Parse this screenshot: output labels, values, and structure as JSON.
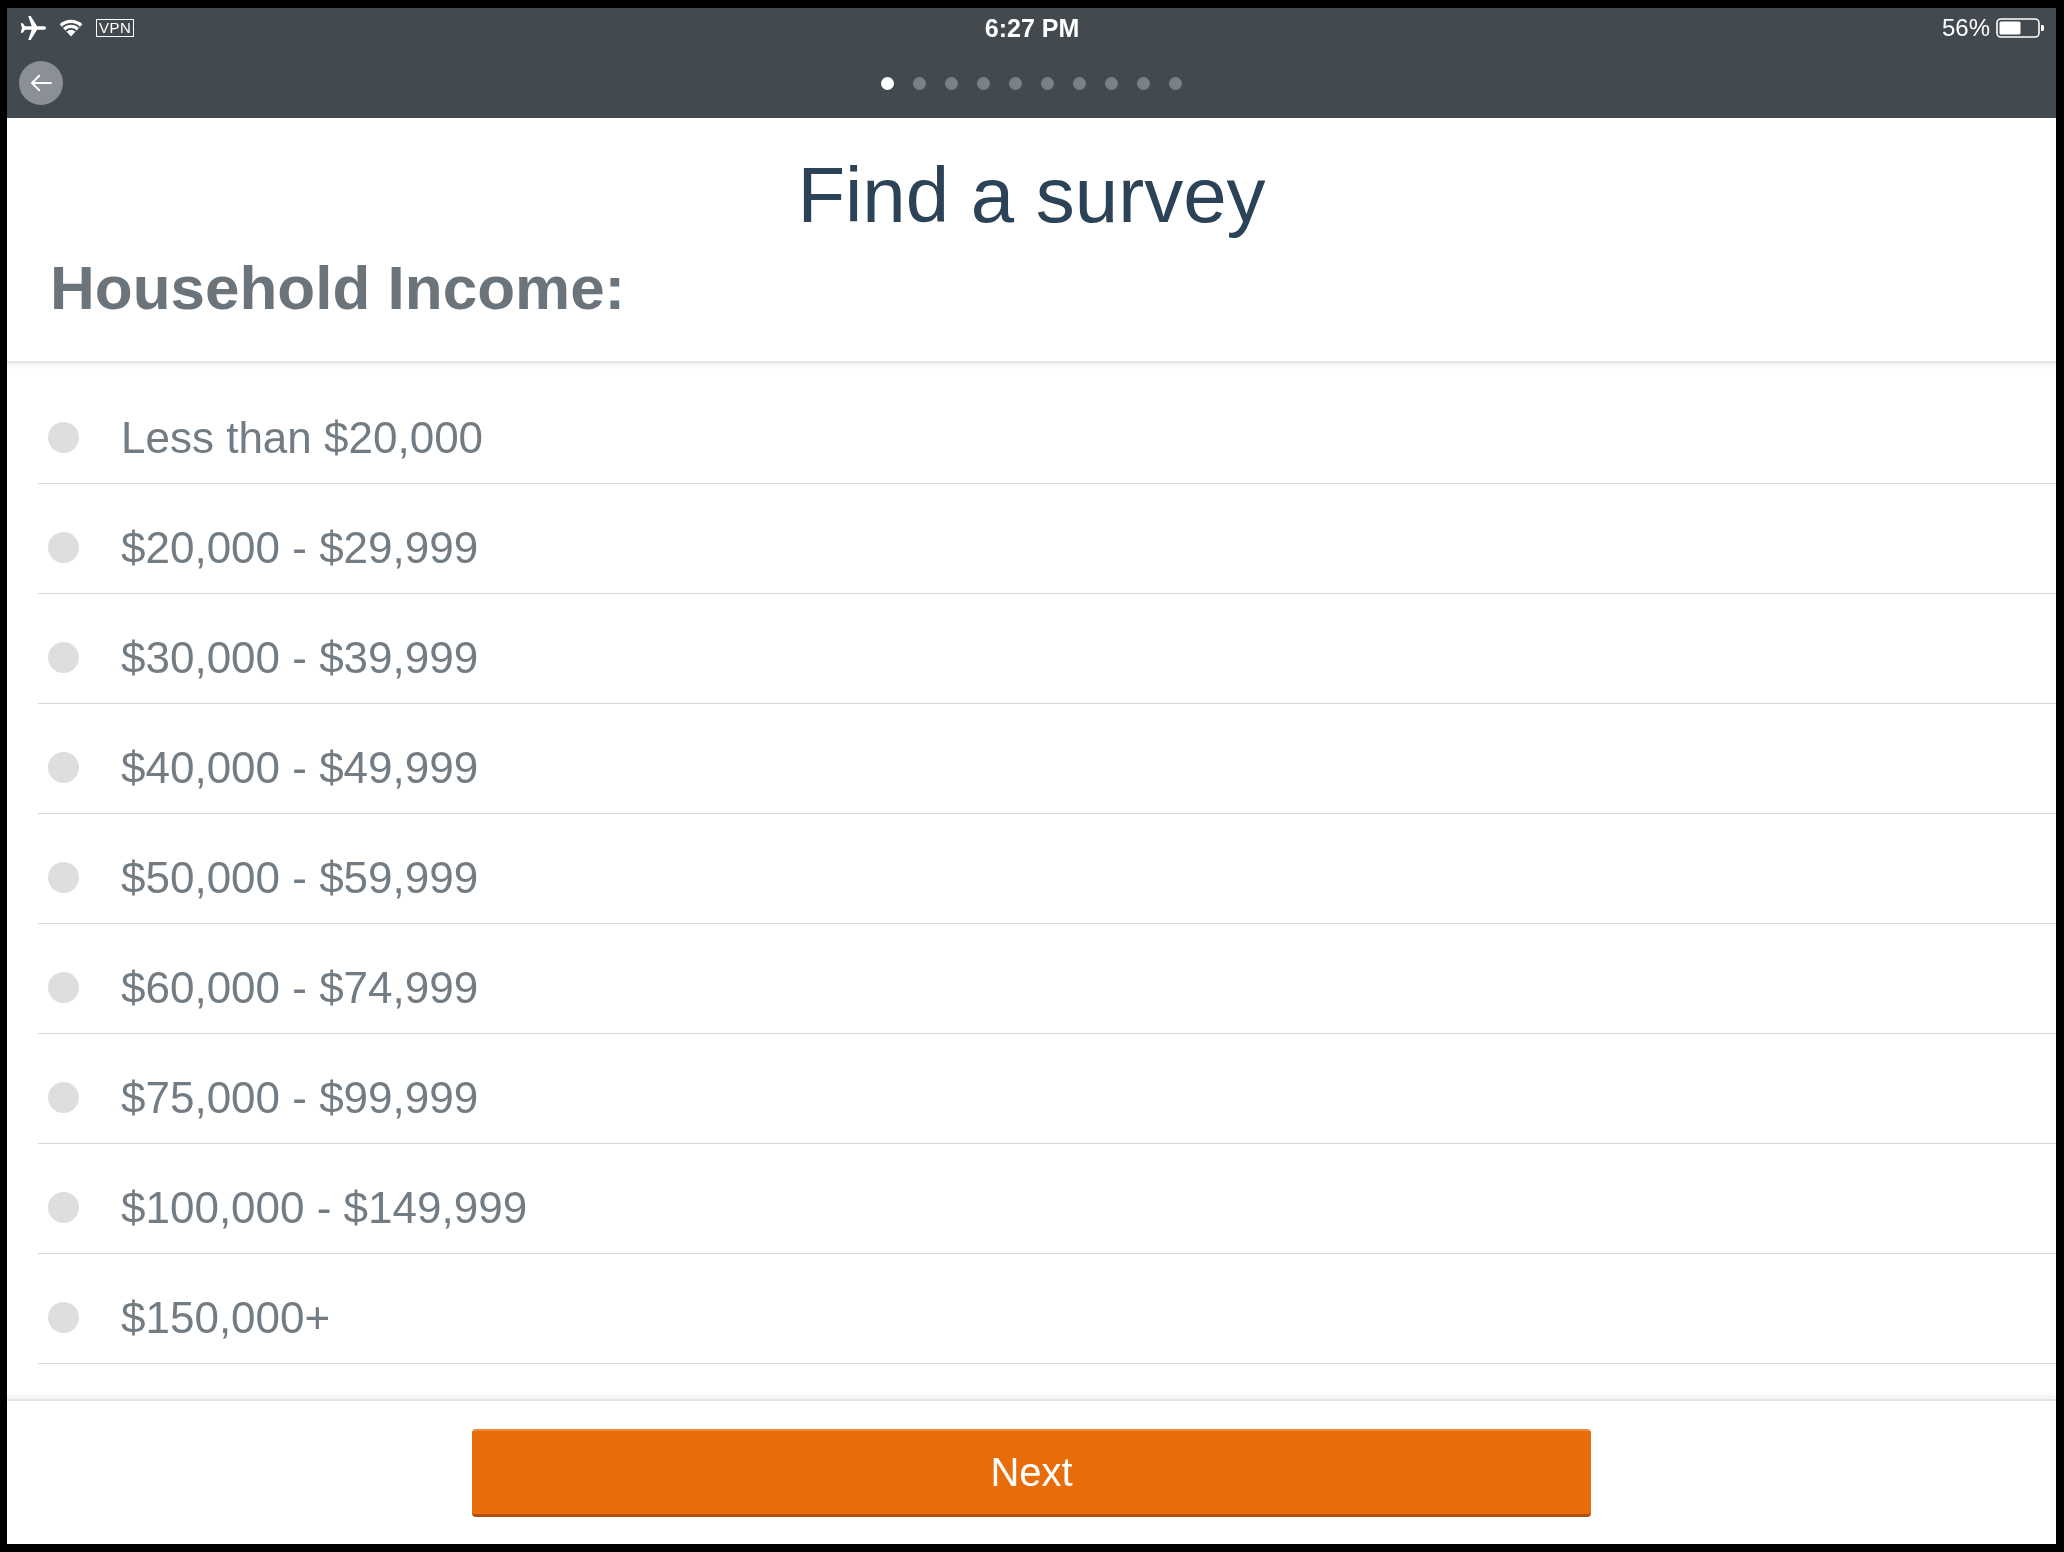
{
  "status_bar": {
    "vpn": "VPN",
    "time": "6:27 PM",
    "battery": "56%"
  },
  "nav": {
    "pages": [
      {
        "selected": true
      },
      {
        "selected": false
      },
      {
        "selected": false
      },
      {
        "selected": false
      },
      {
        "selected": false
      },
      {
        "selected": false
      },
      {
        "selected": false
      },
      {
        "selected": false
      },
      {
        "selected": false
      },
      {
        "selected": false
      }
    ]
  },
  "title": "Find a survey",
  "question": "Household Income:",
  "options": [
    {
      "label": "Less than $20,000",
      "selected": false
    },
    {
      "label": "$20,000 - $29,999",
      "selected": false
    },
    {
      "label": "$30,000 - $39,999",
      "selected": false
    },
    {
      "label": "$40,000 - $49,999",
      "selected": false
    },
    {
      "label": "$50,000 - $59,999",
      "selected": false
    },
    {
      "label": "$60,000 - $74,999",
      "selected": false
    },
    {
      "label": "$75,000 - $99,999",
      "selected": false
    },
    {
      "label": "$100,000 - $149,999",
      "selected": false
    },
    {
      "label": "$150,000+",
      "selected": false
    }
  ],
  "button": "Next"
}
